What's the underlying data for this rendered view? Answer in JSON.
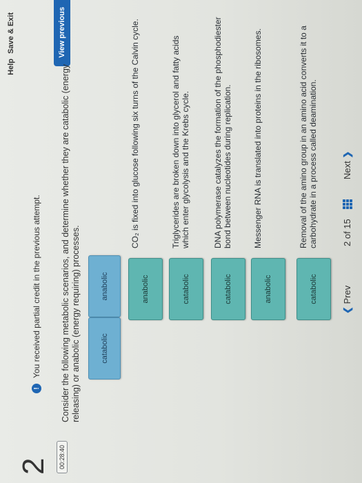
{
  "header": {
    "help_label": "Help",
    "save_exit_label": "Save & Exit"
  },
  "question": {
    "number": "2",
    "timer": "00:28:40",
    "notice": "You received partial credit in the previous attempt.",
    "view_previous_label": "View previous",
    "prompt": "Consider the following metabolic scenarios, and determine whether they are catabolic (energy releasing) or anabolic (energy requiring) processes."
  },
  "bank": [
    {
      "label": "anabolic"
    },
    {
      "label": "catabolic"
    }
  ],
  "rows": [
    {
      "answer": "anabolic",
      "statement": "CO₂ is fixed into glucose following six turns of the Calvin cycle."
    },
    {
      "answer": "catabolic",
      "statement": "Triglycerides are broken down into glycerol and fatty acids which enter glycolysis and the Krebs cycle."
    },
    {
      "answer": "catabolic",
      "statement": "DNA polymerase catalyzes the formation of the phosphodiester bond between nucleotides during replication."
    },
    {
      "answer": "anabolic",
      "statement": "Messenger RNA is translated into proteins in the ribosomes."
    },
    {
      "answer": "catabolic",
      "statement": "Removal of the amino group in an amino acid converts it to a carbohydrate in a process called deamination."
    }
  ],
  "nav": {
    "prev_label": "Prev",
    "page_current": "2",
    "page_of": "of",
    "page_total": "15",
    "next_label": "Next",
    "icons": {
      "prev": "chevron-left-icon",
      "next": "chevron-right-icon",
      "grid": "grid-icon"
    }
  }
}
